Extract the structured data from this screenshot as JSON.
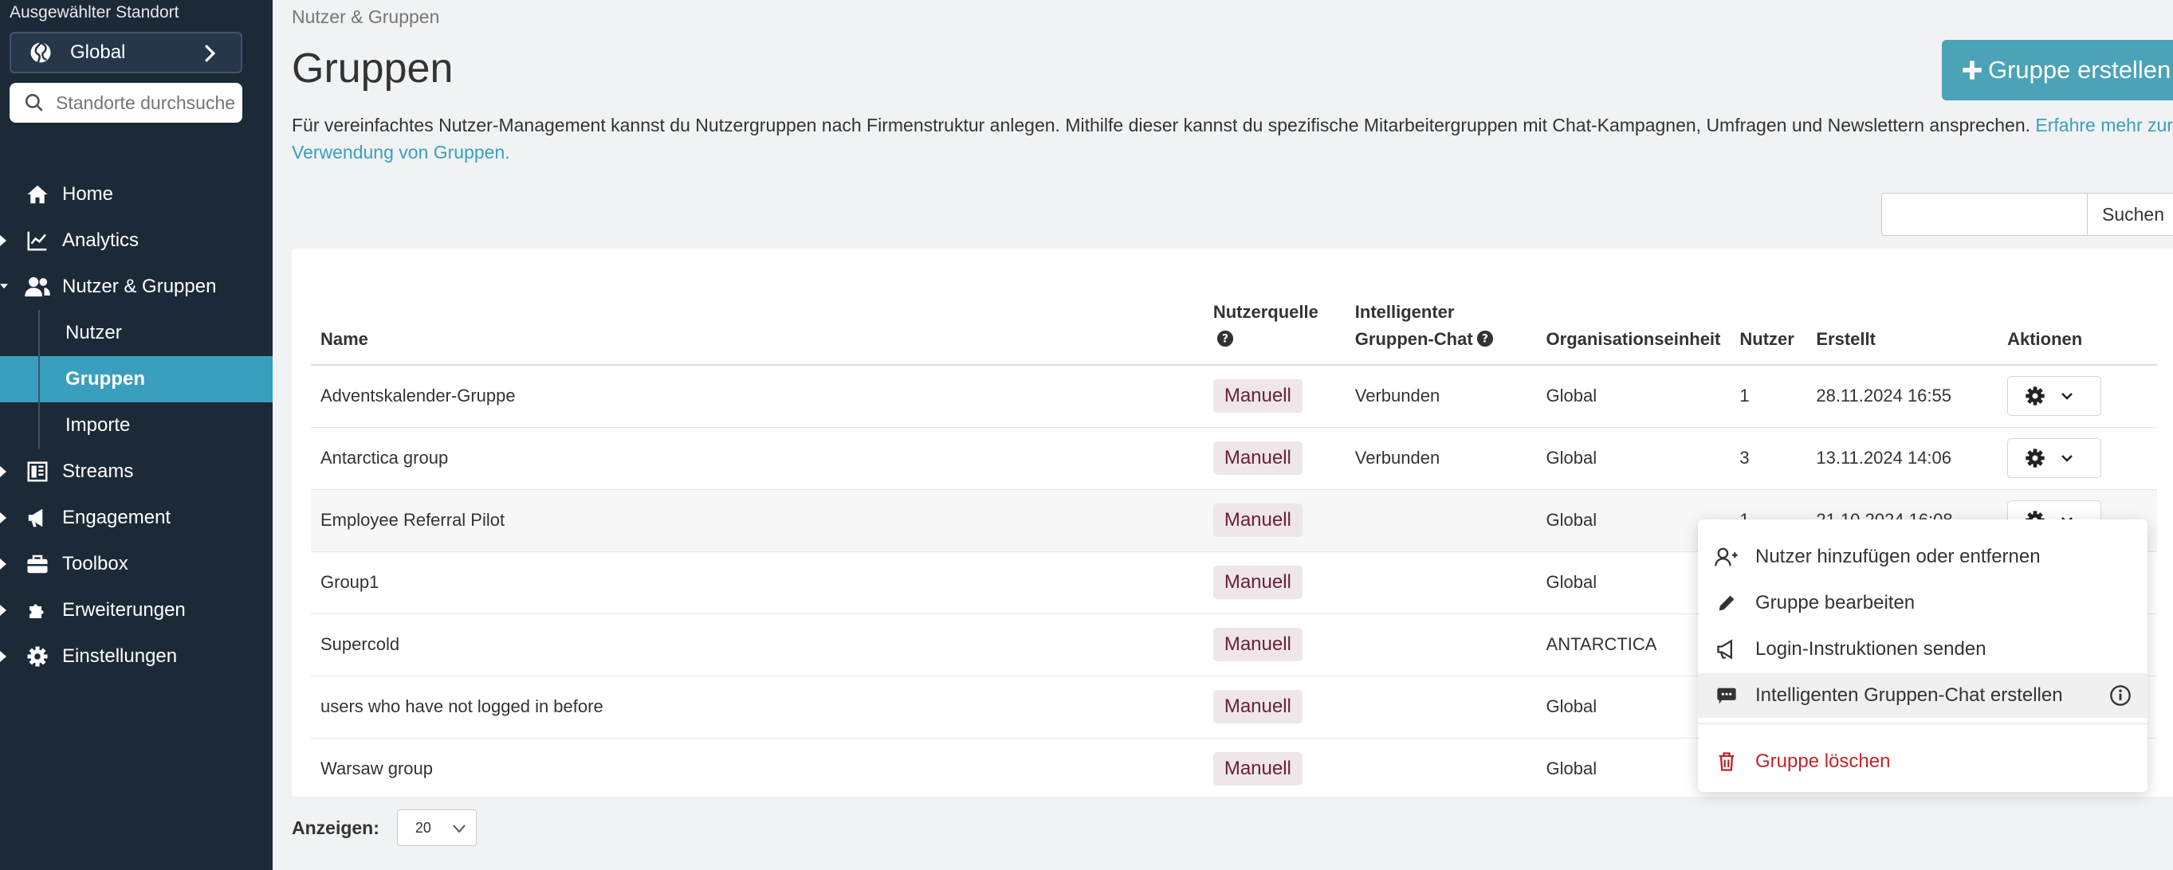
{
  "sidebar": {
    "location_label": "Ausgewählter Standort",
    "location_value": "Global",
    "search_placeholder": "Standorte durchsuchen",
    "nav": {
      "home": "Home",
      "analytics": "Analytics",
      "users_groups": "Nutzer & Gruppen",
      "sub_users": "Nutzer",
      "sub_groups": "Gruppen",
      "sub_imports": "Importe",
      "streams": "Streams",
      "engagement": "Engagement",
      "toolbox": "Toolbox",
      "extensions": "Erweiterungen",
      "settings": "Einstellungen"
    }
  },
  "main": {
    "breadcrumb": "Nutzer & Gruppen",
    "title": "Gruppen",
    "create_button": "Gruppe erstellen",
    "intro_text": "Für vereinfachtes Nutzer-Management kannst du Nutzergruppen nach Firmenstruktur anlegen. Mithilfe dieser kannst du spezifische Mitarbeitergruppen mit Chat-Kampagnen, Umfragen und Newslettern ansprechen. ",
    "intro_link": "Erfahre mehr zur Verwendung von Gruppen.",
    "search_button": "Suchen",
    "search_value": ""
  },
  "table": {
    "headers": {
      "name": "Name",
      "source": "Nutzerquelle",
      "chat_line1": "Intelligenter",
      "chat_line2": "Gruppen-Chat",
      "org": "Organisationseinheit",
      "users": "Nutzer",
      "created": "Erstellt",
      "actions": "Aktionen"
    },
    "rows": [
      {
        "name": "Adventskalender-Gruppe",
        "source": "Manuell",
        "chat": "Verbunden",
        "org": "Global",
        "users": "1",
        "created": "28.11.2024 16:55"
      },
      {
        "name": "Antarctica group",
        "source": "Manuell",
        "chat": "Verbunden",
        "org": "Global",
        "users": "3",
        "created": "13.11.2024 14:06"
      },
      {
        "name": "Employee Referral Pilot",
        "source": "Manuell",
        "chat": "",
        "org": "Global",
        "users": "1",
        "created": "21.10.2024 16:08"
      },
      {
        "name": "Group1",
        "source": "Manuell",
        "chat": "",
        "org": "Global",
        "users": "",
        "created": ""
      },
      {
        "name": "Supercold",
        "source": "Manuell",
        "chat": "",
        "org": "ANTARCTICA",
        "users": "",
        "created": ""
      },
      {
        "name": "users who have not logged in before",
        "source": "Manuell",
        "chat": "",
        "org": "Global",
        "users": "",
        "created": ""
      },
      {
        "name": "Warsaw group",
        "source": "Manuell",
        "chat": "",
        "org": "Global",
        "users": "",
        "created": ""
      }
    ]
  },
  "footer": {
    "show_label": "Anzeigen:",
    "page_size": "20"
  },
  "menu": {
    "add_remove_users": "Nutzer hinzufügen oder entfernen",
    "edit_group": "Gruppe bearbeiten",
    "send_login": "Login-Instruktionen senden",
    "create_chat": "Intelligenten Gruppen-Chat erstellen",
    "delete_group": "Gruppe löschen"
  },
  "colors": {
    "sidebar_bg": "#1c2a38",
    "accent": "#3a9fbe",
    "create_button": "#4aa3b6",
    "badge_bg": "#eee6e8",
    "badge_text": "#6b1e38",
    "danger": "#c0242b"
  }
}
